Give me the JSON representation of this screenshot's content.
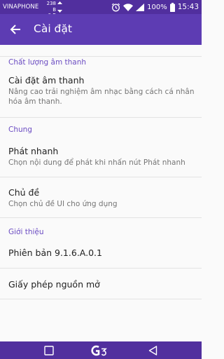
{
  "status_bar": {
    "carrier": "VINAPHONE",
    "net_up": "238 B",
    "net_down": "0 B",
    "battery_percent": "100%",
    "time": "15:43",
    "icons": [
      "alarm-icon",
      "wifi-icon",
      "signal-icon",
      "battery-icon"
    ]
  },
  "app_bar": {
    "title": "Cài đặt",
    "back_icon": "back-arrow-icon"
  },
  "sections": [
    {
      "header": "Chất lượng âm thanh",
      "items": [
        {
          "title": "Cài đặt âm thanh",
          "description": "Nâng cao trải nghiệm âm nhạc bằng cách cá nhân hóa âm thanh."
        }
      ]
    },
    {
      "header": "Chung",
      "items": [
        {
          "title": "Phát nhanh",
          "description": "Chọn nội dung để phát khi nhấn nút Phát nhanh"
        },
        {
          "title": "Chủ đề",
          "description": "Chọn chủ đề UI cho ứng dụng"
        }
      ]
    },
    {
      "header": "Giới thiệu",
      "items": [
        {
          "title": "Phiên bản 9.1.6.A.0.1"
        },
        {
          "title": "Giấy phép nguồn mở"
        }
      ]
    }
  ],
  "nav_bar": {
    "buttons": [
      "recent-apps-icon",
      "home-g3-icon",
      "back-triangle-icon"
    ]
  },
  "colors": {
    "status_bar": "#512f9e",
    "app_bar": "#5d3cb3",
    "section_header": "#6b4cc2",
    "background": "#fafafa"
  }
}
